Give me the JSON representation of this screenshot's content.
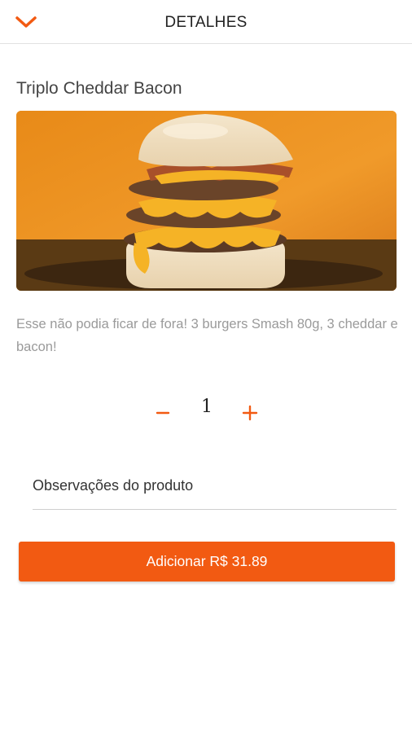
{
  "header": {
    "title": "DETALHES",
    "back_icon": "chevron-down-icon",
    "accent_color": "#f25a12"
  },
  "product": {
    "name": "Triplo Cheddar Bacon",
    "description": "Esse não podia ficar de fora! 3 burgers Smash 80g, 3 cheddar e bacon!",
    "image_alt": "triple cheddar bacon burger"
  },
  "quantity": {
    "value": "1",
    "minus_icon": "minus-icon",
    "plus_icon": "plus-icon"
  },
  "notes": {
    "placeholder": "Observações do produto"
  },
  "add_button": {
    "label": "Adicionar R$ 31.89"
  }
}
